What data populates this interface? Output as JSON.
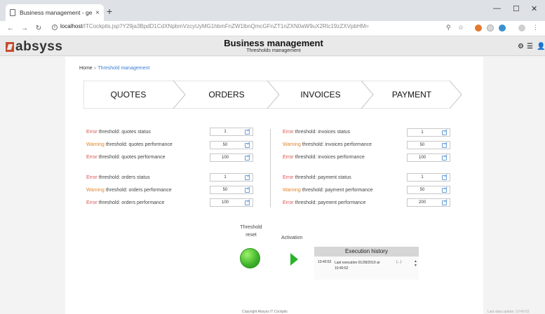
{
  "browser": {
    "tab_title": "Business management - gestion",
    "tab_close": "×",
    "new_tab": "+",
    "url_host": "localhost",
    "url_path": "/ITCockpits.jsp?Y29ja3BpdD1CdXNpbmVzcyUyMG1hbmFnZW1lbnQmcGFnZT1nZXN0aW9uX2Rlc19zZXVpbHM="
  },
  "app": {
    "logo": "absyss",
    "title": "Business management",
    "subtitle": "Thresholds management"
  },
  "breadcrumb": {
    "home": "Home",
    "separator": "»",
    "current": "Threshold management"
  },
  "steps": [
    "QUOTES",
    "ORDERS",
    "INVOICES",
    "PAYMENT"
  ],
  "thresholds_left": [
    {
      "level": "Error",
      "rest": "threshold: quotes status",
      "value": "1"
    },
    {
      "level": "Warning",
      "rest": "threshold: quotes performance",
      "value": "50"
    },
    {
      "level": "Error",
      "rest": "threshold: quotes performance",
      "value": "100"
    },
    {
      "level": "Error",
      "rest": "threshold: orders status",
      "value": "1"
    },
    {
      "level": "Warning",
      "rest": "threshold: orders performance",
      "value": "50"
    },
    {
      "level": "Error",
      "rest": "threshold: orders performance",
      "value": "100"
    }
  ],
  "thresholds_right": [
    {
      "level": "Error",
      "rest": "threshold: invoices status",
      "value": "1"
    },
    {
      "level": "Warning",
      "rest": "threshold: invoices performance",
      "value": "50"
    },
    {
      "level": "Error",
      "rest": "threshold: invoices performance",
      "value": "100"
    },
    {
      "level": "Error",
      "rest": "threshold: payment status",
      "value": "1"
    },
    {
      "level": "Warning",
      "rest": "threshold: payment performance",
      "value": "50"
    },
    {
      "level": "Error",
      "rest": "threshold: payment performance",
      "value": "200"
    }
  ],
  "reset": {
    "line1": "Threshold",
    "line2": "reset"
  },
  "activation": {
    "label": "Activation"
  },
  "history": {
    "title": "Execution history",
    "time": "10:40:52",
    "text": "Last execution 01/28/2019 at 10:40:52",
    "info": "(...)"
  },
  "footer": {
    "center": "Copyright Absyss  IT Cockpits",
    "right": "Last data update: 10:40:52"
  },
  "colors": {
    "error": "#d9534f",
    "warning": "#e0862a",
    "link": "#3a7fd5",
    "go": "#2ab42a"
  }
}
